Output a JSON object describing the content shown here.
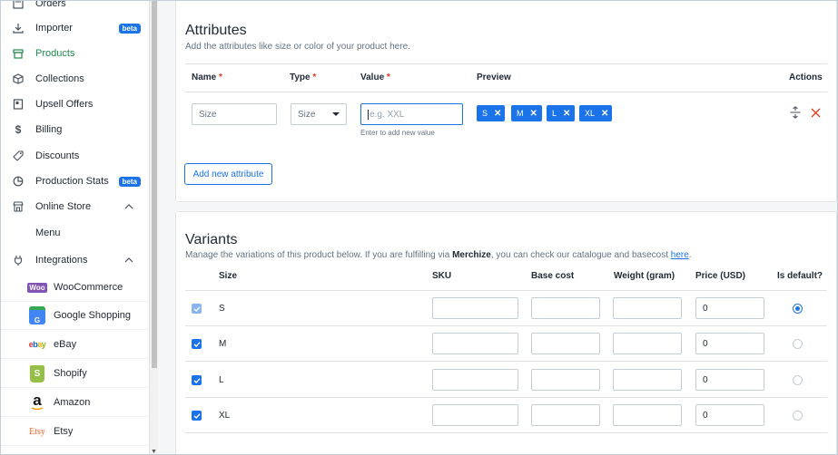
{
  "sidebar": {
    "items": [
      {
        "label": "Orders",
        "icon": "orders-icon"
      },
      {
        "label": "Importer",
        "icon": "import-icon",
        "badge": "beta"
      },
      {
        "label": "Products",
        "icon": "products-icon",
        "active": true
      },
      {
        "label": "Collections",
        "icon": "collections-icon"
      },
      {
        "label": "Upsell Offers",
        "icon": "upsell-icon"
      },
      {
        "label": "Billing",
        "icon": "dollar-icon"
      },
      {
        "label": "Discounts",
        "icon": "tag-icon"
      },
      {
        "label": "Production Stats",
        "icon": "pie-chart-icon",
        "badge": "beta"
      },
      {
        "label": "Online Store",
        "icon": "store-icon"
      },
      {
        "label": "Menu"
      },
      {
        "label": "Integrations",
        "icon": "plug-icon"
      }
    ],
    "integrations": [
      {
        "label": "WooCommerce",
        "logo_text": "Woo"
      },
      {
        "label": "Google Shopping",
        "logo_text": "G"
      },
      {
        "label": "eBay",
        "logo_text": "ebay"
      },
      {
        "label": "Shopify",
        "logo_text": "S"
      },
      {
        "label": "Amazon",
        "logo_text": "a"
      },
      {
        "label": "Etsy",
        "logo_text": "Etsy"
      }
    ]
  },
  "attributes": {
    "title": "Attributes",
    "subtitle": "Add the attributes like size or color of your product here.",
    "headers": {
      "name": "Name",
      "type": "Type",
      "value": "Value",
      "preview": "Preview",
      "actions": "Actions",
      "required_mark": "*"
    },
    "name_placeholder": "Size",
    "type_value": "Size",
    "value_placeholder": "e.g. XXL",
    "value_hint": "Enter to add new value",
    "chips": [
      "S",
      "M",
      "L",
      "XL"
    ],
    "add_button": "Add new attribute"
  },
  "variants": {
    "title": "Variants",
    "subtitle_pre": "Manage the variations of this product below. If you are fulfilling via ",
    "subtitle_brand": "Merchize",
    "subtitle_mid": ", you can check our catalogue and basecost ",
    "subtitle_link": "here",
    "subtitle_end": ".",
    "headers": {
      "size": "Size",
      "sku": "SKU",
      "base_cost": "Base cost",
      "weight": "Weight (gram)",
      "price": "Price (USD)",
      "default": "Is default?"
    },
    "rows": [
      {
        "size": "S",
        "price": "0",
        "checked": true,
        "default": true
      },
      {
        "size": "M",
        "price": "0",
        "checked": true,
        "default": false
      },
      {
        "size": "L",
        "price": "0",
        "checked": true,
        "default": false
      },
      {
        "size": "XL",
        "price": "0",
        "checked": true,
        "default": false
      }
    ]
  },
  "colors": {
    "accent": "#1a73e8",
    "active_nav": "#1e8a4c",
    "danger": "#de3618"
  }
}
